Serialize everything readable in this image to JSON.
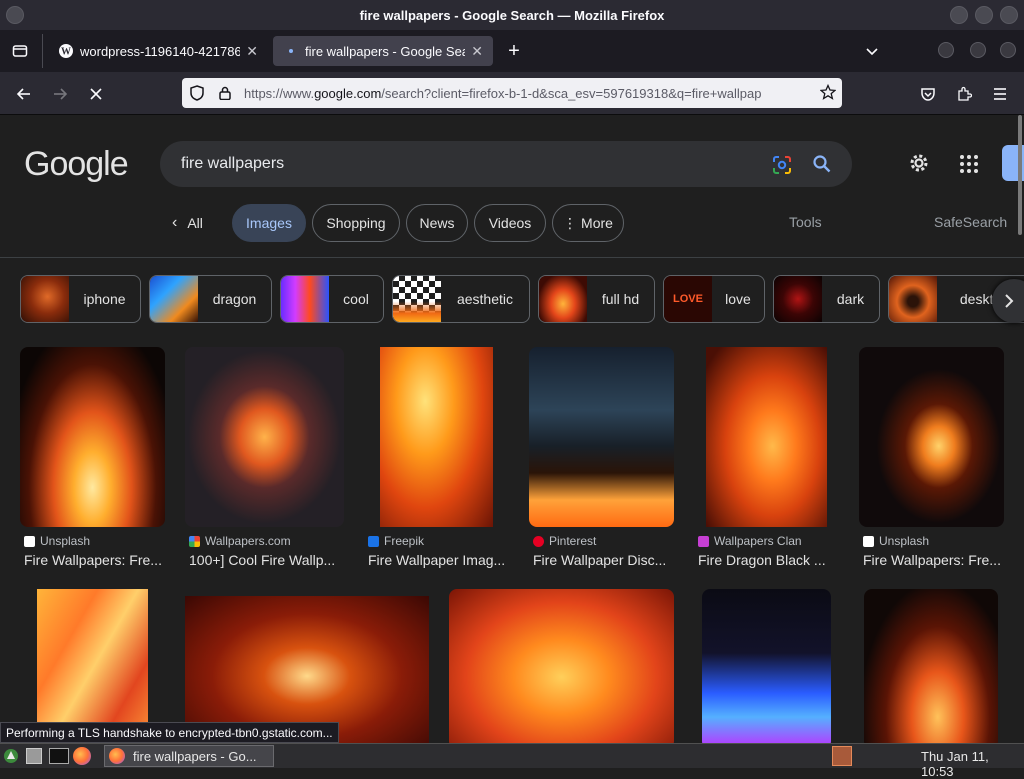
{
  "window": {
    "title": "fire wallpapers - Google Search — Mozilla Firefox"
  },
  "tabs": [
    {
      "label": "wordpress-1196140-421786",
      "icon": "wordpress-icon"
    },
    {
      "label": "fire wallpapers - Google Sea",
      "icon": "google-icon"
    }
  ],
  "url": {
    "prefix": "https://www.",
    "domain": "google.com",
    "rest": "/search?client=firefox-b-1-d&sca_esv=597619318&q=fire+wallpap"
  },
  "google": {
    "logo": "Google",
    "query": "fire wallpapers",
    "filters": [
      "All",
      "Images",
      "Shopping",
      "News",
      "Videos",
      "More"
    ],
    "tools": "Tools",
    "safesearch": "SafeSearch"
  },
  "chips": [
    "iphone",
    "dragon",
    "cool",
    "aesthetic",
    "full hd",
    "love",
    "dark",
    "deskto"
  ],
  "chip_love_text": "LOVE",
  "results": [
    {
      "source": "Unsplash",
      "caption": "Fire Wallpapers: Fre..."
    },
    {
      "source": "Wallpapers.com",
      "caption": "100+] Cool Fire Wallp..."
    },
    {
      "source": "Freepik",
      "caption": "Fire Wallpaper Imag..."
    },
    {
      "source": "Pinterest",
      "caption": "Fire Wallpaper Disc..."
    },
    {
      "source": "Wallpapers Clan",
      "caption": "Fire Dragon Black ..."
    },
    {
      "source": "Unsplash",
      "caption": "Fire Wallpapers: Fre..."
    }
  ],
  "status": "Performing a TLS handshake to encrypted-tbn0.gstatic.com...",
  "taskbar": {
    "window_label": "fire wallpapers - Go...",
    "clock": "Thu Jan 11, 10:53"
  },
  "colors": {
    "accent": "#8ab4f8",
    "selected_filter_bg": "#394457",
    "page_bg": "#1f1f1f"
  }
}
